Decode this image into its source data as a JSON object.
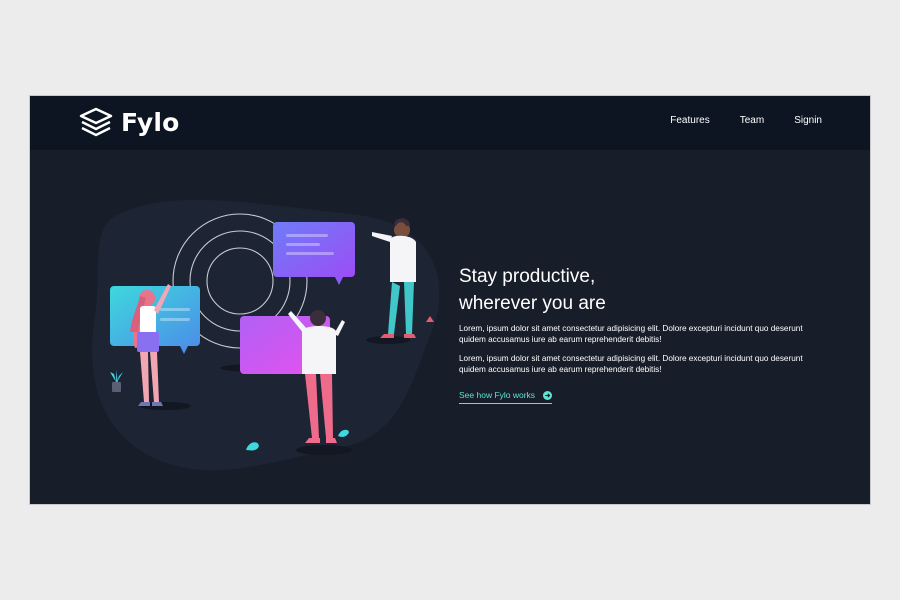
{
  "brand": {
    "name": "Fylo",
    "icon": "stacked-layers-icon"
  },
  "nav": {
    "items": [
      "Features",
      "Team",
      "Signin"
    ]
  },
  "hero": {
    "heading_line1": "Stay productive,",
    "heading_line2": "wherever you are",
    "paragraph1": "Lorem, ipsum dolor sit amet consectetur adipisicing elit. Dolore excepturi incidunt quo deserunt quidem accusamus iure ab earum reprehenderit debitis!",
    "paragraph2": "Lorem, ipsum dolor sit amet consectetur adipisicing elit. Dolore excepturi incidunt quo deserunt quidem accusamus iure ab earum reprehenderit debitis!",
    "cta_label": "See how Fylo works",
    "cta_icon": "arrow-right-circle-icon",
    "illustration": "people-holding-chat-bubbles-illustration"
  },
  "colors": {
    "page_background": "#ececed",
    "topbar": "#0d1523",
    "hero_background": "#181e29",
    "accent": "#5de4d4"
  }
}
